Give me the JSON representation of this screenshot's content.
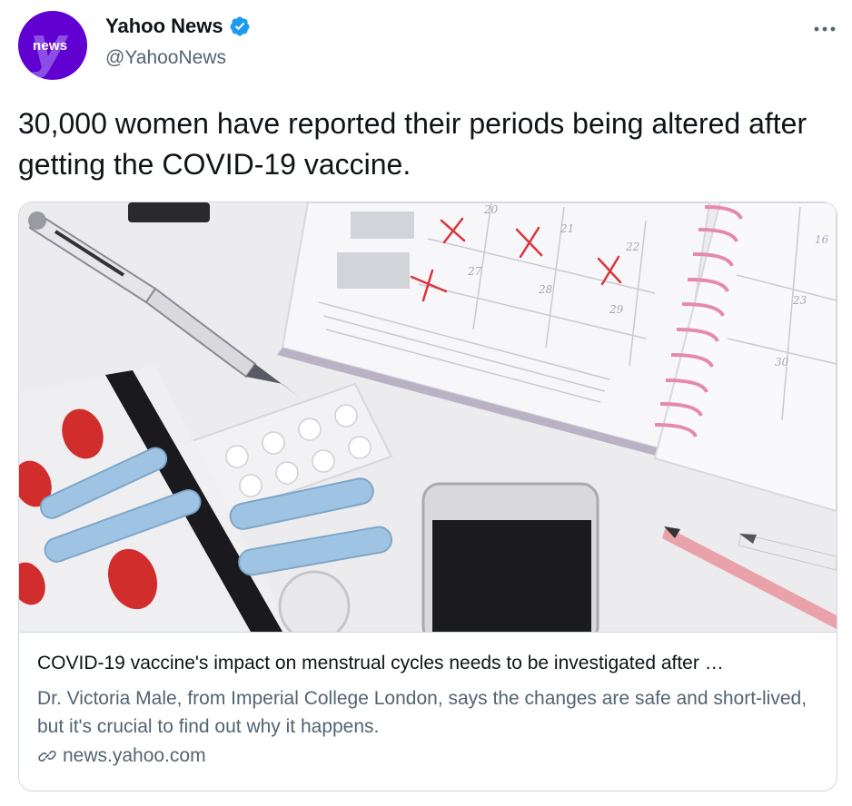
{
  "author": {
    "display_name": "Yahoo News",
    "handle": "@YahooNews",
    "avatar_text": "news",
    "avatar_color": "#6001d2",
    "verified_color": "#1d9bf0"
  },
  "tweet": {
    "text": "30,000 women have reported their periods being altered after getting the COVID-19 vaccine."
  },
  "card": {
    "title": "COVID-19 vaccine's impact on menstrual cycles needs to be investigated after …",
    "description": "Dr. Victoria Male, from Imperial College London, says the changes are safe and short-lived, but it's crucial to find out why it happens.",
    "domain": "news.yahoo.com",
    "calendar_numbers": [
      "20",
      "21",
      "22",
      "27",
      "28",
      "29",
      "16",
      "23",
      "30"
    ]
  },
  "icons": {
    "more": "more-horizontal-icon",
    "verified": "verified-badge-icon",
    "link": "link-icon"
  }
}
